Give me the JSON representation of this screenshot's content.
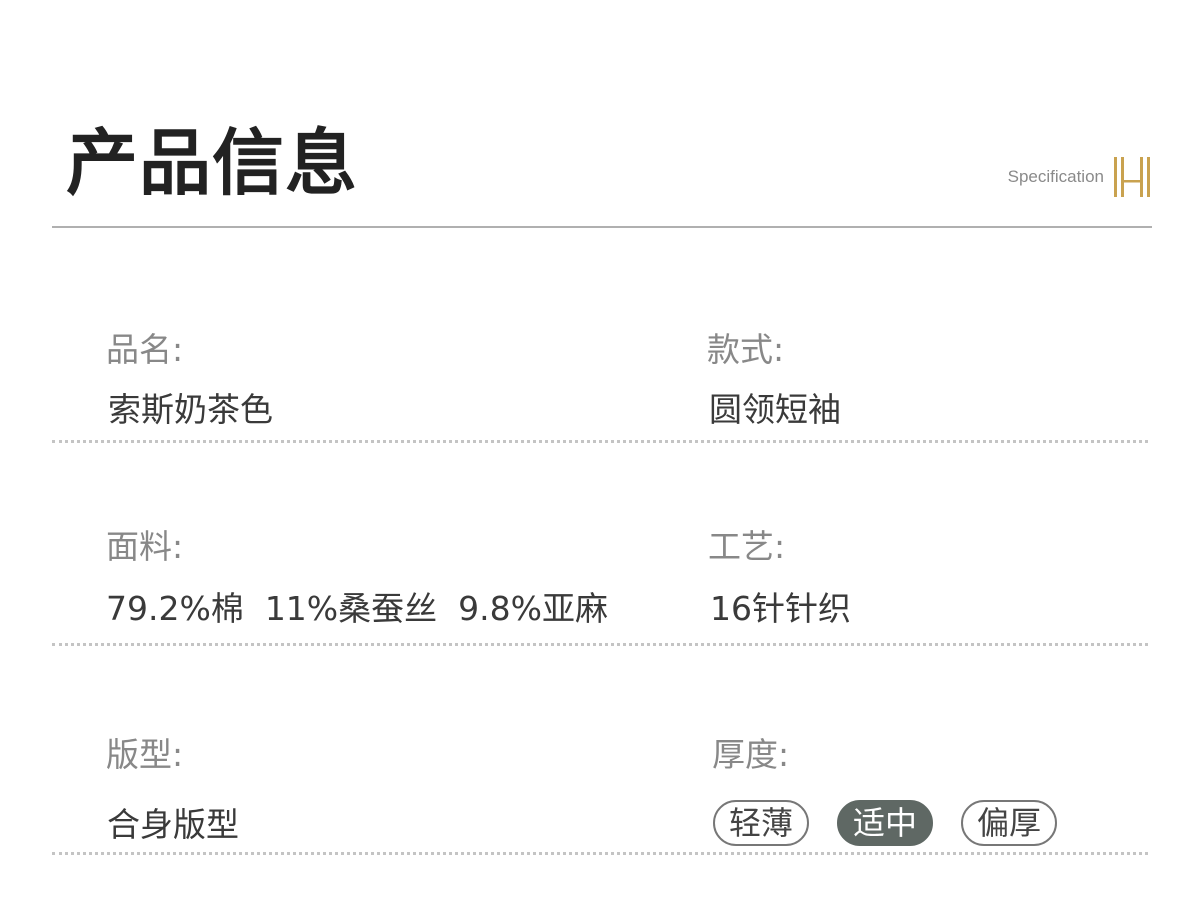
{
  "header": {
    "title": "产品信息",
    "subtitle": "Specification",
    "logo_icon": "H-monogram-icon",
    "logo_color": "#c9a24f"
  },
  "specs": {
    "name": {
      "label": "品名:",
      "value": "索斯奶茶色"
    },
    "style": {
      "label": "款式:",
      "value": "圆领短袖"
    },
    "fabric": {
      "label": "面料:",
      "value": "79.2%棉  11%桑蚕丝  9.8%亚麻"
    },
    "craft": {
      "label": "工艺:",
      "value": "16针针织"
    },
    "fit": {
      "label": "版型:",
      "value": "合身版型"
    },
    "thickness": {
      "label": "厚度:",
      "options": [
        "轻薄",
        "适中",
        "偏厚"
      ],
      "selected": "适中"
    }
  },
  "colors": {
    "selected_pill": "#5f6864",
    "rule": "#b0b0b0",
    "dotted": "#c4c4c4"
  }
}
